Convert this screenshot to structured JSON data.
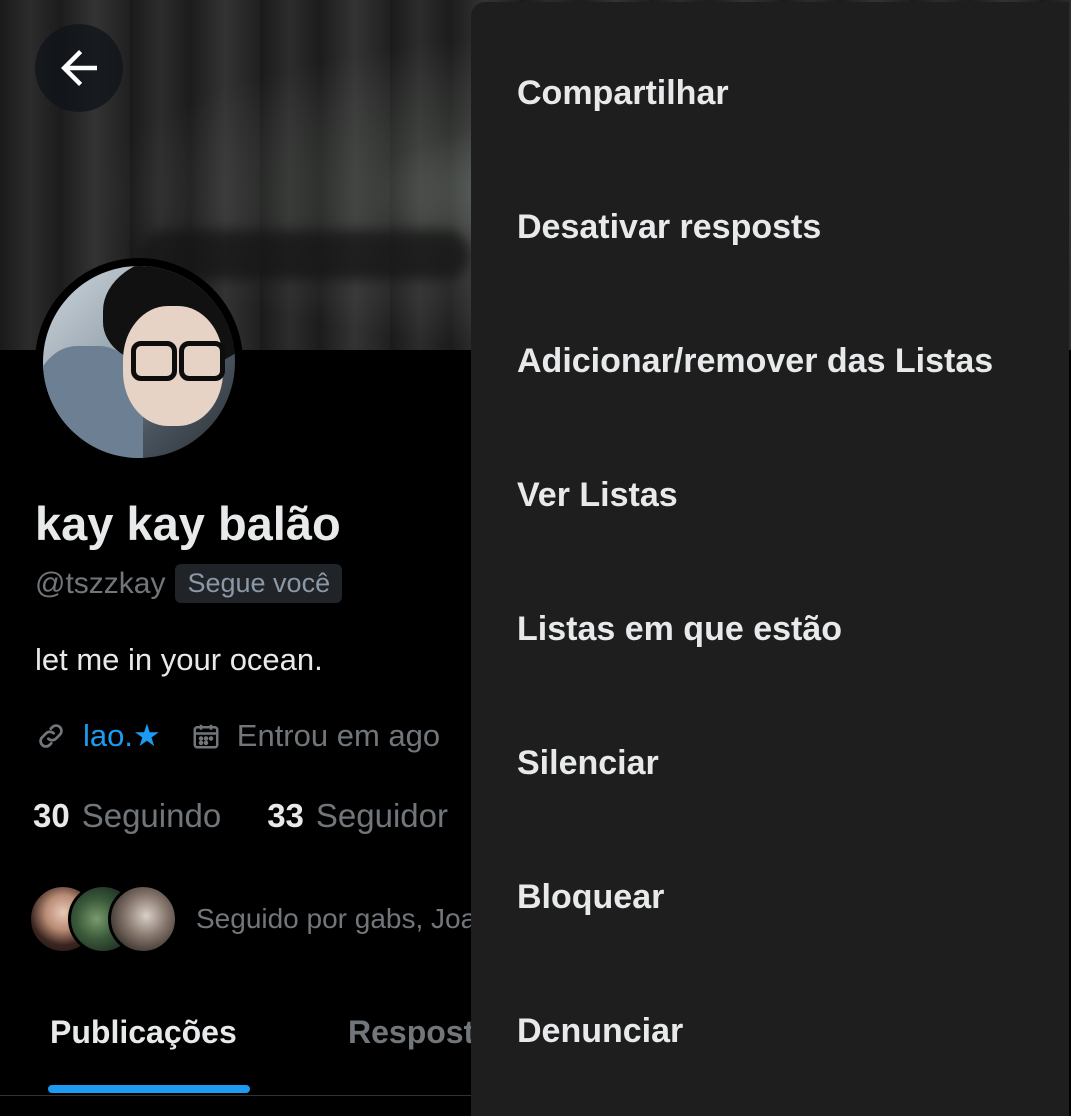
{
  "profile": {
    "name": "kay kay balão",
    "handle": "@tszzkay",
    "follows_you": "Segue você",
    "bio": "let me in your ocean.",
    "link": "lao.★",
    "joined": "Entrou em ago",
    "following_count": "30",
    "following_label": "Seguindo",
    "followers_count": "33",
    "followers_label": "Seguidor",
    "followed_by": "Seguido por gabs, Joao"
  },
  "tabs": [
    {
      "label": "Publicações",
      "active": true
    },
    {
      "label": "Respost",
      "active": false
    }
  ],
  "menu": {
    "items": [
      {
        "label": "Compartilhar"
      },
      {
        "label": "Desativar resposts"
      },
      {
        "label": "Adicionar/remover das Listas"
      },
      {
        "label": "Ver Listas"
      },
      {
        "label": "Listas em que estão"
      },
      {
        "label": "Silenciar"
      },
      {
        "label": "Bloquear"
      },
      {
        "label": "Denunciar"
      }
    ]
  },
  "icons": {
    "back": "arrow-left-icon",
    "link": "link-icon",
    "calendar": "calendar-icon"
  },
  "colors": {
    "accent": "#1d9bf0",
    "menu_background": "#1e1e1e",
    "secondary_text": "#71767b"
  }
}
